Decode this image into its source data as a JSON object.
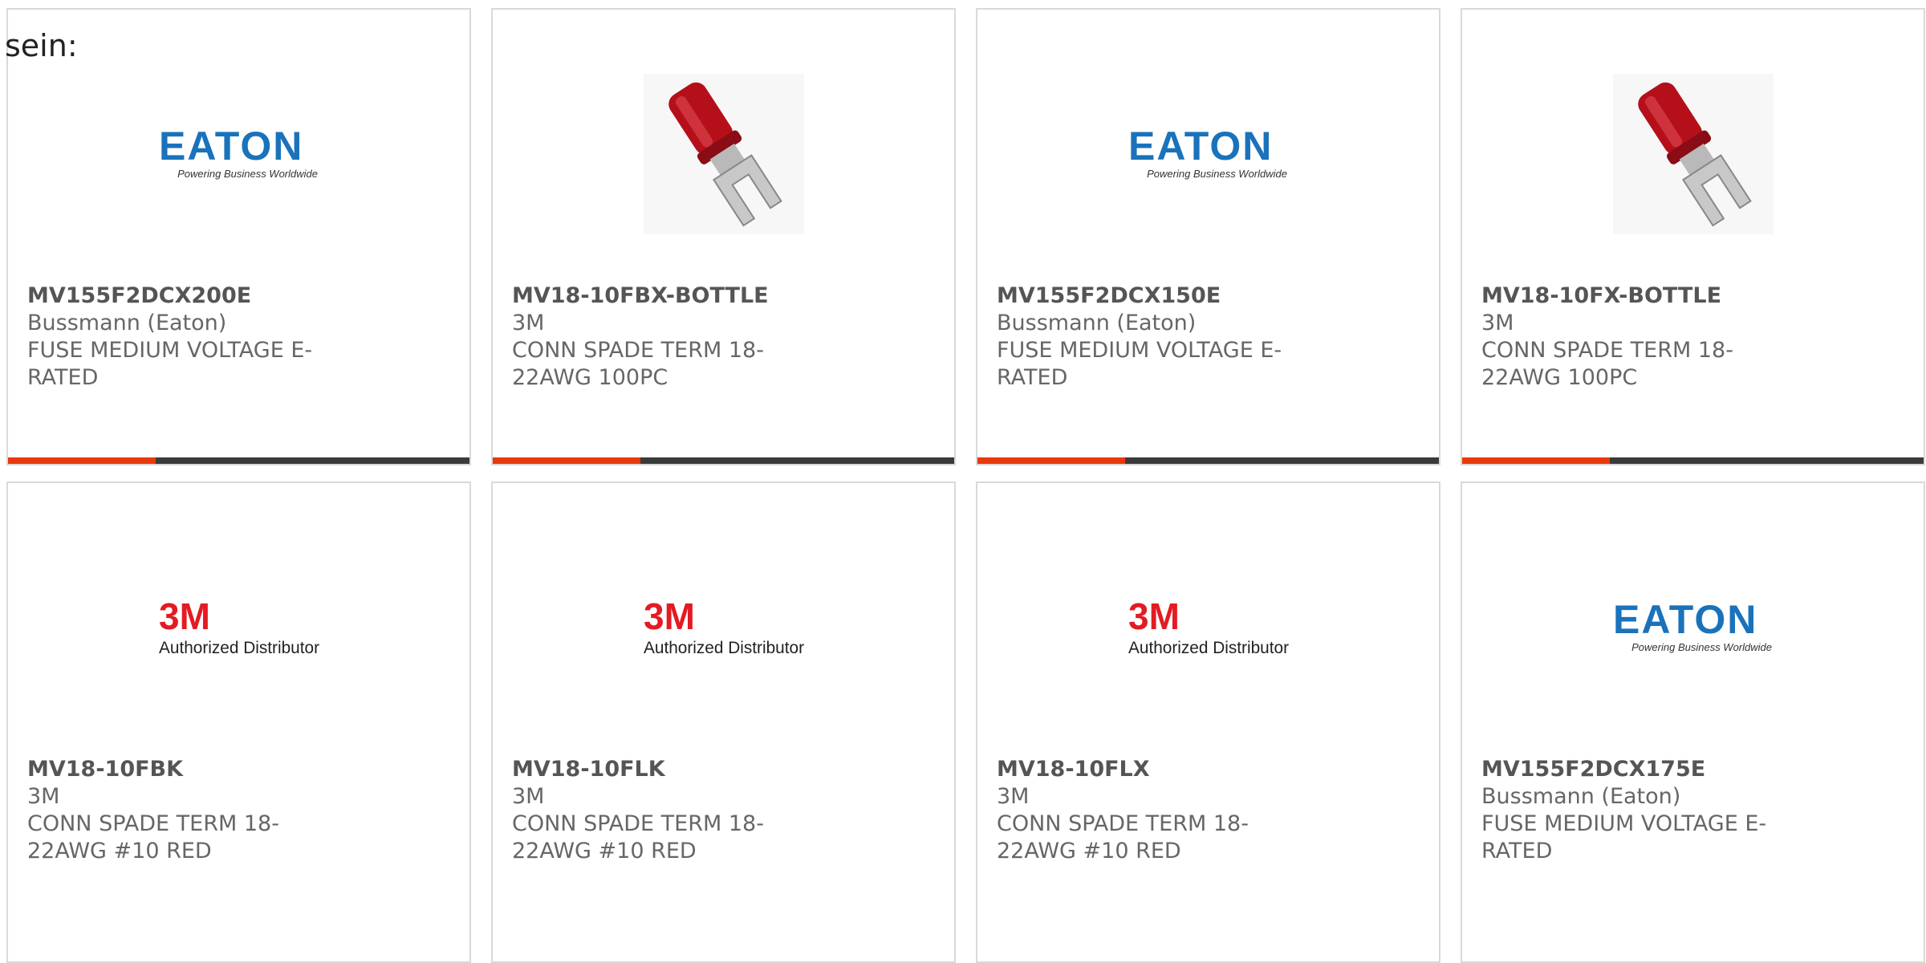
{
  "intro_text": "sein:",
  "colors": {
    "accent": "#e8380d",
    "bar": "#3a3a3a",
    "card_border": "#d9d9d9",
    "eaton_blue": "#1a72bb",
    "threem_red": "#e31b23",
    "terminal_red": "#b5101a"
  },
  "products": [
    {
      "part_number": "MV155F2DCX200E",
      "manufacturer": "Bussmann (Eaton)",
      "description": "FUSE MEDIUM VOLTAGE E-RATED",
      "image": "eaton-logo"
    },
    {
      "part_number": "MV18-10FBX-BOTTLE",
      "manufacturer": "3M",
      "description": "CONN SPADE TERM 18-22AWG 100PC",
      "image": "spade-terminal-photo"
    },
    {
      "part_number": "MV155F2DCX150E",
      "manufacturer": "Bussmann (Eaton)",
      "description": "FUSE MEDIUM VOLTAGE E-RATED",
      "image": "eaton-logo"
    },
    {
      "part_number": "MV18-10FX-BOTTLE",
      "manufacturer": "3M",
      "description": "CONN SPADE TERM 18-22AWG 100PC",
      "image": "spade-terminal-photo"
    },
    {
      "part_number": "MV18-10FBK",
      "manufacturer": "3M",
      "description": "CONN SPADE TERM 18-22AWG #10 RED",
      "image": "3m-logo"
    },
    {
      "part_number": "MV18-10FLK",
      "manufacturer": "3M",
      "description": "CONN SPADE TERM 18-22AWG #10 RED",
      "image": "3m-logo"
    },
    {
      "part_number": "MV18-10FLX",
      "manufacturer": "3M",
      "description": "CONN SPADE TERM 18-22AWG #10 RED",
      "image": "3m-logo"
    },
    {
      "part_number": "MV155F2DCX175E",
      "manufacturer": "Bussmann (Eaton)",
      "description": "FUSE MEDIUM VOLTAGE E-RATED",
      "image": "eaton-logo"
    }
  ],
  "logos": {
    "eaton": {
      "wordmark": "EATON",
      "tagline": "Powering Business Worldwide"
    },
    "threem": {
      "wordmark": "3M",
      "caption": "Authorized Distributor"
    }
  }
}
